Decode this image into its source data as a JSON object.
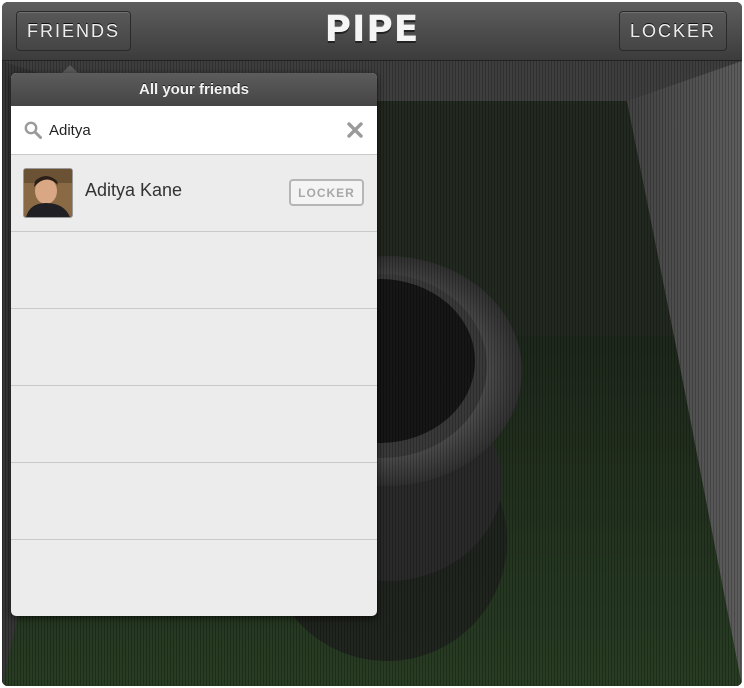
{
  "topbar": {
    "friends_label": "FRIENDS",
    "title": "PIPE",
    "locker_label": "LOCKER"
  },
  "friends_panel": {
    "header": "All your friends",
    "search": {
      "value": "Aditya",
      "icon": "search-icon"
    },
    "clear_icon": "close-icon",
    "results": [
      {
        "name": "Aditya Kane",
        "action_label": "LOCKER"
      }
    ],
    "empty_rows": 5
  },
  "colors": {
    "topbar": "#4a4a4a",
    "panel_bg": "#ececec",
    "floor_green": "#22311f"
  }
}
